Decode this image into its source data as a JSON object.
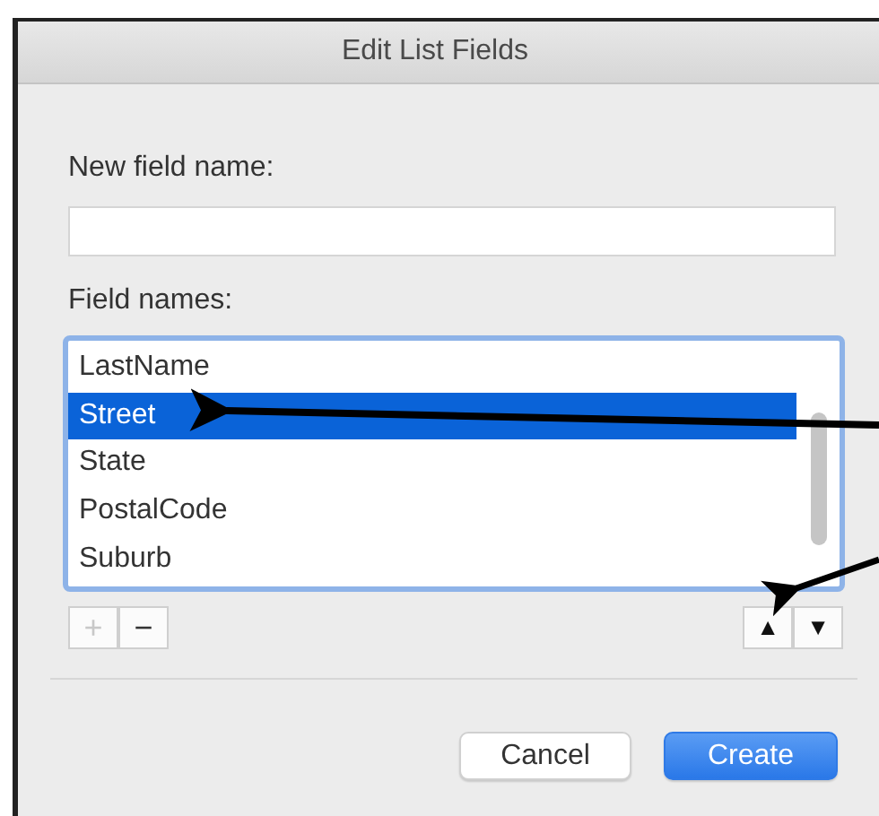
{
  "window": {
    "title": "Edit List Fields"
  },
  "new_field": {
    "label": "New field name:"
  },
  "field_names": {
    "label": "Field names:",
    "items": [
      {
        "name": "LastName",
        "selected": false
      },
      {
        "name": "Street",
        "selected": true
      },
      {
        "name": "State",
        "selected": false
      },
      {
        "name": "PostalCode",
        "selected": false
      },
      {
        "name": "Suburb",
        "selected": false
      }
    ]
  },
  "list_buttons": [
    {
      "symbol": "+",
      "disabled": true
    },
    {
      "symbol": "−",
      "disabled": false
    }
  ],
  "move_buttons": [
    {
      "symbol": "▲"
    },
    {
      "symbol": "▼"
    }
  ],
  "buttons": [
    {
      "label": "Cancel",
      "kind": "secondary"
    },
    {
      "label": "Create",
      "kind": "primary"
    }
  ]
}
